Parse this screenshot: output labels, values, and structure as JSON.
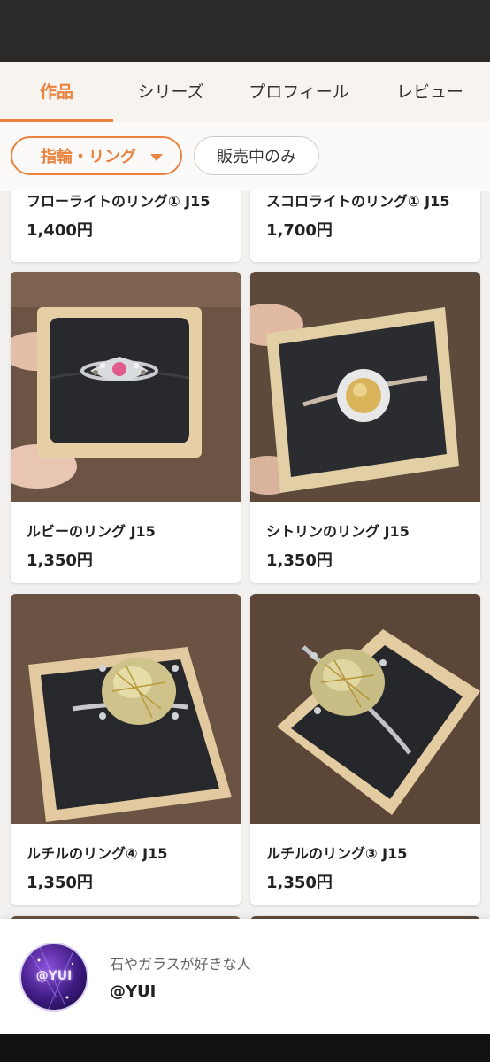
{
  "tabs": [
    "作品",
    "シリーズ",
    "プロフィール",
    "レビュー"
  ],
  "active_tab": 0,
  "filters": {
    "category_label": "指輪・リング",
    "onsale_label": "販売中のみ"
  },
  "products": [
    {
      "title": "フローライトのリング① J15",
      "price": "1,400円"
    },
    {
      "title": "スコロライトのリング① J15",
      "price": "1,700円"
    },
    {
      "title": "ルビーのリング J15",
      "price": "1,350円"
    },
    {
      "title": "シトリンのリング J15",
      "price": "1,350円"
    },
    {
      "title": "ルチルのリング④ J15",
      "price": "1,350円"
    },
    {
      "title": "ルチルのリング③ J15",
      "price": "1,350円"
    }
  ],
  "profile": {
    "description": "石やガラスが好きな人",
    "handle": "@YUI",
    "avatar_text": "@YUI"
  },
  "colors": {
    "accent": "#e8843f",
    "status_bar": "#2b2a28"
  }
}
